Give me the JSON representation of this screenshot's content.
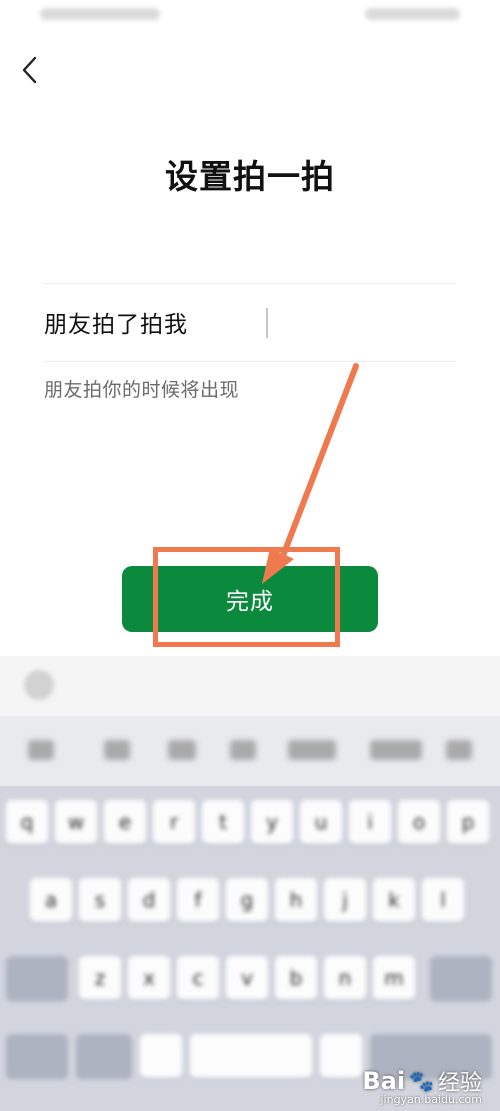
{
  "header": {
    "title": "设置拍一拍"
  },
  "form": {
    "input_value": "朋友拍了拍我",
    "hint": "朋友拍你的时候将出现"
  },
  "actions": {
    "done_label": "完成"
  },
  "colors": {
    "primary_green": "#0b8a3e",
    "annotation_orange": "#ef7a4f"
  },
  "keyboard": {
    "row1": [
      "q",
      "w",
      "e",
      "r",
      "t",
      "y",
      "u",
      "i",
      "o",
      "p"
    ],
    "row2": [
      "a",
      "s",
      "d",
      "f",
      "g",
      "h",
      "j",
      "k",
      "l"
    ],
    "row3": [
      "z",
      "x",
      "c",
      "v",
      "b",
      "n",
      "m"
    ]
  },
  "watermark": {
    "brand": "Bai",
    "brand2": "经验",
    "site": "jingyan.baidu.com"
  }
}
